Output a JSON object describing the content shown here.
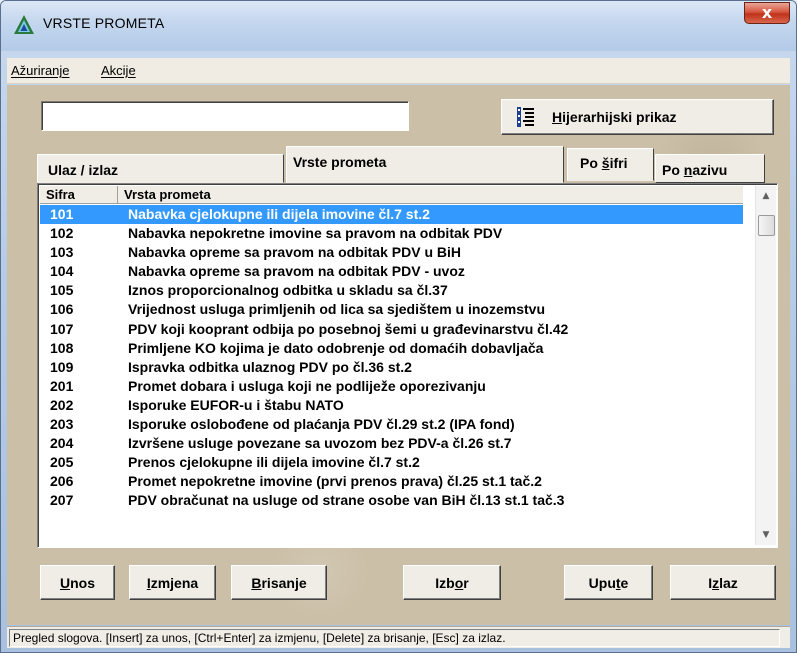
{
  "window": {
    "title": "VRSTE PROMETA",
    "close_label": "x"
  },
  "menu": [
    {
      "label": "Ažuriranje"
    },
    {
      "label": "Akcije"
    }
  ],
  "search": {
    "value": "",
    "placeholder": ""
  },
  "hier_button": {
    "label": "Hijerarhijski prikaz",
    "icon": "hierarchy-icon"
  },
  "tabs": {
    "ulaz_izlaz": "Ulaz / izlaz",
    "vrste_prometa": "Vrste prometa",
    "po_sifri": "Po šifri",
    "po_nazivu": "Po nazivu"
  },
  "table": {
    "columns": [
      "Sifra",
      "Vrsta prometa"
    ],
    "rows": [
      {
        "code": "101",
        "name": "Nabavka cjelokupne ili dijela imovine čl.7 st.2",
        "selected": true
      },
      {
        "code": "102",
        "name": "Nabavka nepokretne imovine sa pravom na odbitak PDV"
      },
      {
        "code": "103",
        "name": "Nabavka opreme sa pravom na odbitak PDV u BiH"
      },
      {
        "code": "104",
        "name": "Nabavka opreme sa pravom na odbitak PDV - uvoz"
      },
      {
        "code": "105",
        "name": "Iznos proporcionalnog odbitka u skladu sa čl.37"
      },
      {
        "code": "106",
        "name": "Vrijednost usluga primljenih od lica sa sjedištem u inozemstvu"
      },
      {
        "code": "107",
        "name": "PDV koji kooprant odbija po posebnoj šemi u građevinarstvu čl.42"
      },
      {
        "code": "108",
        "name": "Primljene KO kojima je dato odobrenje od domaćih dobavljača"
      },
      {
        "code": "109",
        "name": "Ispravka odbitka ulaznog PDV po čl.36 st.2"
      },
      {
        "code": "201",
        "name": "Promet dobara i usluga koji ne podliježe oporezivanju"
      },
      {
        "code": "202",
        "name": "Isporuke EUFOR-u i štabu NATO"
      },
      {
        "code": "203",
        "name": "Isporuke oslobođene od plaćanja PDV čl.29 st.2 (IPA fond)"
      },
      {
        "code": "204",
        "name": "Izvršene usluge povezane sa uvozom bez PDV-a čl.26 st.7"
      },
      {
        "code": "205",
        "name": "Prenos cjelokupne ili dijela imovine čl.7 st.2"
      },
      {
        "code": "206",
        "name": "Promet nepokretne imovine (prvi prenos prava) čl.25 st.1 tač.2"
      },
      {
        "code": "207",
        "name": "PDV obračunat na usluge od strane osobe van BiH čl.13 st.1 tač.3"
      }
    ]
  },
  "buttons": {
    "unos": "Unos",
    "izmjena": "Izmjena",
    "brisanje": "Brisanje",
    "izbor": "Izbor",
    "upute": "Upute",
    "izlaz": "Izlaz"
  },
  "status": "Pregled slogova. [Insert] za unos, [Ctrl+Enter] za izmjenu, [Delete] za brisanje, [Esc] za izlaz.",
  "colors": {
    "selection": "#3399ff",
    "client_background": "#cbbfa7",
    "close_button": "#c0321c"
  }
}
